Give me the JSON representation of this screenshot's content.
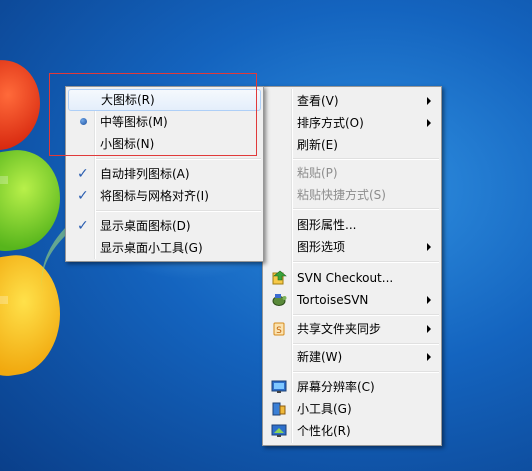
{
  "view_submenu": {
    "items": [
      {
        "label": "大图标(R)",
        "state": "hover"
      },
      {
        "label": "中等图标(M)",
        "state": "radio-selected"
      },
      {
        "label": "小图标(N)",
        "state": "normal"
      },
      {
        "label": "自动排列图标(A)",
        "state": "checked"
      },
      {
        "label": "将图标与网格对齐(I)",
        "state": "checked"
      },
      {
        "label": "显示桌面图标(D)",
        "state": "checked"
      },
      {
        "label": "显示桌面小工具(G)",
        "state": "normal"
      }
    ]
  },
  "context_menu": {
    "items": [
      {
        "label": "查看(V)",
        "submenu": true
      },
      {
        "label": "排序方式(O)",
        "submenu": true
      },
      {
        "label": "刷新(E)"
      },
      {
        "label": "粘贴(P)",
        "disabled": true
      },
      {
        "label": "粘贴快捷方式(S)",
        "disabled": true
      },
      {
        "label": "图形属性..."
      },
      {
        "label": "图形选项",
        "submenu": true
      },
      {
        "label": "SVN Checkout...",
        "icon": "svn-checkout-icon"
      },
      {
        "label": "TortoiseSVN",
        "icon": "tortoisesvn-icon",
        "submenu": true
      },
      {
        "label": "共享文件夹同步",
        "icon": "sync-folder-icon",
        "submenu": true
      },
      {
        "label": "新建(W)",
        "submenu": true
      },
      {
        "label": "屏幕分辨率(C)",
        "icon": "display-resolution-icon"
      },
      {
        "label": "小工具(G)",
        "icon": "gadgets-icon"
      },
      {
        "label": "个性化(R)",
        "icon": "personalize-icon"
      }
    ]
  },
  "colors": {
    "menu_bg": "#f0f0f0",
    "hover_border": "#aecff7",
    "annotation_border": "#e03a3a",
    "desktop_blue": "#1464bf"
  }
}
